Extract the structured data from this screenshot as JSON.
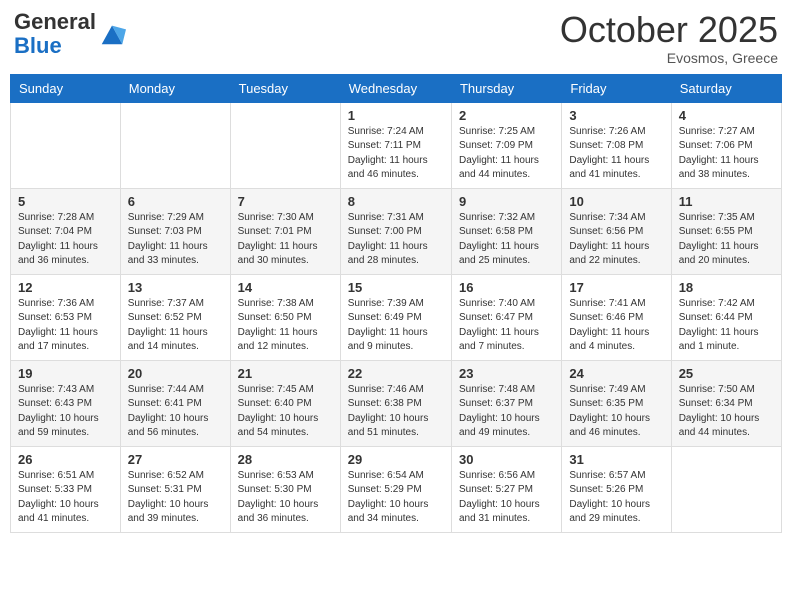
{
  "header": {
    "logo_general": "General",
    "logo_blue": "Blue",
    "month": "October 2025",
    "location": "Evosmos, Greece"
  },
  "weekdays": [
    "Sunday",
    "Monday",
    "Tuesday",
    "Wednesday",
    "Thursday",
    "Friday",
    "Saturday"
  ],
  "weeks": [
    [
      {
        "day": "",
        "info": ""
      },
      {
        "day": "",
        "info": ""
      },
      {
        "day": "",
        "info": ""
      },
      {
        "day": "1",
        "info": "Sunrise: 7:24 AM\nSunset: 7:11 PM\nDaylight: 11 hours and 46 minutes."
      },
      {
        "day": "2",
        "info": "Sunrise: 7:25 AM\nSunset: 7:09 PM\nDaylight: 11 hours and 44 minutes."
      },
      {
        "day": "3",
        "info": "Sunrise: 7:26 AM\nSunset: 7:08 PM\nDaylight: 11 hours and 41 minutes."
      },
      {
        "day": "4",
        "info": "Sunrise: 7:27 AM\nSunset: 7:06 PM\nDaylight: 11 hours and 38 minutes."
      }
    ],
    [
      {
        "day": "5",
        "info": "Sunrise: 7:28 AM\nSunset: 7:04 PM\nDaylight: 11 hours and 36 minutes."
      },
      {
        "day": "6",
        "info": "Sunrise: 7:29 AM\nSunset: 7:03 PM\nDaylight: 11 hours and 33 minutes."
      },
      {
        "day": "7",
        "info": "Sunrise: 7:30 AM\nSunset: 7:01 PM\nDaylight: 11 hours and 30 minutes."
      },
      {
        "day": "8",
        "info": "Sunrise: 7:31 AM\nSunset: 7:00 PM\nDaylight: 11 hours and 28 minutes."
      },
      {
        "day": "9",
        "info": "Sunrise: 7:32 AM\nSunset: 6:58 PM\nDaylight: 11 hours and 25 minutes."
      },
      {
        "day": "10",
        "info": "Sunrise: 7:34 AM\nSunset: 6:56 PM\nDaylight: 11 hours and 22 minutes."
      },
      {
        "day": "11",
        "info": "Sunrise: 7:35 AM\nSunset: 6:55 PM\nDaylight: 11 hours and 20 minutes."
      }
    ],
    [
      {
        "day": "12",
        "info": "Sunrise: 7:36 AM\nSunset: 6:53 PM\nDaylight: 11 hours and 17 minutes."
      },
      {
        "day": "13",
        "info": "Sunrise: 7:37 AM\nSunset: 6:52 PM\nDaylight: 11 hours and 14 minutes."
      },
      {
        "day": "14",
        "info": "Sunrise: 7:38 AM\nSunset: 6:50 PM\nDaylight: 11 hours and 12 minutes."
      },
      {
        "day": "15",
        "info": "Sunrise: 7:39 AM\nSunset: 6:49 PM\nDaylight: 11 hours and 9 minutes."
      },
      {
        "day": "16",
        "info": "Sunrise: 7:40 AM\nSunset: 6:47 PM\nDaylight: 11 hours and 7 minutes."
      },
      {
        "day": "17",
        "info": "Sunrise: 7:41 AM\nSunset: 6:46 PM\nDaylight: 11 hours and 4 minutes."
      },
      {
        "day": "18",
        "info": "Sunrise: 7:42 AM\nSunset: 6:44 PM\nDaylight: 11 hours and 1 minute."
      }
    ],
    [
      {
        "day": "19",
        "info": "Sunrise: 7:43 AM\nSunset: 6:43 PM\nDaylight: 10 hours and 59 minutes."
      },
      {
        "day": "20",
        "info": "Sunrise: 7:44 AM\nSunset: 6:41 PM\nDaylight: 10 hours and 56 minutes."
      },
      {
        "day": "21",
        "info": "Sunrise: 7:45 AM\nSunset: 6:40 PM\nDaylight: 10 hours and 54 minutes."
      },
      {
        "day": "22",
        "info": "Sunrise: 7:46 AM\nSunset: 6:38 PM\nDaylight: 10 hours and 51 minutes."
      },
      {
        "day": "23",
        "info": "Sunrise: 7:48 AM\nSunset: 6:37 PM\nDaylight: 10 hours and 49 minutes."
      },
      {
        "day": "24",
        "info": "Sunrise: 7:49 AM\nSunset: 6:35 PM\nDaylight: 10 hours and 46 minutes."
      },
      {
        "day": "25",
        "info": "Sunrise: 7:50 AM\nSunset: 6:34 PM\nDaylight: 10 hours and 44 minutes."
      }
    ],
    [
      {
        "day": "26",
        "info": "Sunrise: 6:51 AM\nSunset: 5:33 PM\nDaylight: 10 hours and 41 minutes."
      },
      {
        "day": "27",
        "info": "Sunrise: 6:52 AM\nSunset: 5:31 PM\nDaylight: 10 hours and 39 minutes."
      },
      {
        "day": "28",
        "info": "Sunrise: 6:53 AM\nSunset: 5:30 PM\nDaylight: 10 hours and 36 minutes."
      },
      {
        "day": "29",
        "info": "Sunrise: 6:54 AM\nSunset: 5:29 PM\nDaylight: 10 hours and 34 minutes."
      },
      {
        "day": "30",
        "info": "Sunrise: 6:56 AM\nSunset: 5:27 PM\nDaylight: 10 hours and 31 minutes."
      },
      {
        "day": "31",
        "info": "Sunrise: 6:57 AM\nSunset: 5:26 PM\nDaylight: 10 hours and 29 minutes."
      },
      {
        "day": "",
        "info": ""
      }
    ]
  ]
}
